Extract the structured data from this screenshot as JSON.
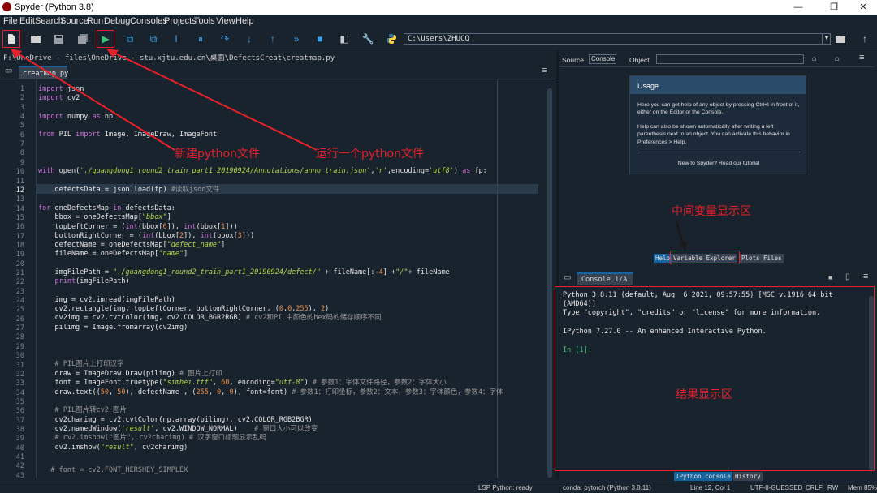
{
  "window": {
    "title": "Spyder (Python 3.8)",
    "minimize": "—",
    "maximize": "❐",
    "close": "✕"
  },
  "menu": [
    "File",
    "Edit",
    "Search",
    "Source",
    "Run",
    "Debug",
    "Consoles",
    "Projects",
    "Tools",
    "View",
    "Help"
  ],
  "toolbar": {
    "path": "C:\\Users\\ZHUCQ"
  },
  "editor": {
    "file_path": "F:\\OneDrive - files\\OneDrive - stu.xjtu.edu.cn\\桌面\\DefectsCreat\\creatmap.py",
    "tab_label": "creatmap.py",
    "tab_close": "✕",
    "line_numbers": [
      "1",
      "2",
      "3",
      "4",
      "5",
      "6",
      "7",
      "8",
      "9",
      "10",
      "11",
      "12",
      "13",
      "14",
      "15",
      "16",
      "17",
      "18",
      "19",
      "20",
      "21",
      "22",
      "23",
      "24",
      "25",
      "26",
      "27",
      "28",
      "29",
      "30",
      "31",
      "32",
      "33",
      "34",
      "35",
      "36",
      "37",
      "38",
      "39",
      "40",
      "41",
      "42",
      "43"
    ],
    "current_line": "12"
  },
  "right_pane": {
    "source_label": "Source",
    "source_value": "Console",
    "object_label": "Object",
    "usage_title": "Usage",
    "usage_p1": "Here you can get help of any object by pressing Ctrl+I in front of it, either on the Editor or the Console.",
    "usage_p2": "Help can also be shown automatically after writing a left parenthesis next to an object. You can activate this behavior in Preferences > Help.",
    "usage_p3": "New to Spyder? Read our tutorial",
    "tabs": [
      "Help",
      "Variable Explorer",
      "Plots",
      "Files"
    ]
  },
  "console": {
    "tab_label": "Console 1/A",
    "lines": [
      "Python 3.8.11 (default, Aug  6 2021, 09:57:55) [MSC v.1916 64 bit",
      "(AMD64)]",
      "Type \"copyright\", \"credits\" or \"license\" for more information.",
      "",
      "IPython 7.27.0 -- An enhanced Interactive Python.",
      "",
      "In [1]:"
    ],
    "tabs": [
      "IPython console",
      "History"
    ]
  },
  "status": {
    "lsp": "LSP Python: ready",
    "conda": "conda: pytorch (Python 3.8.11)",
    "position": "Line 12, Col 1",
    "encoding": "UTF-8-GUESSED",
    "eol": "CRLF",
    "rw": "RW",
    "mem": "Mem 85%"
  },
  "annotations": {
    "new_file": "新建python文件",
    "run_file": "运行一个python文件",
    "var_area": "中间变量显示区",
    "result_area": "结果显示区"
  },
  "colors": {
    "annotation": "#e8202a",
    "background": "#19232d",
    "accent": "#1464a0"
  }
}
